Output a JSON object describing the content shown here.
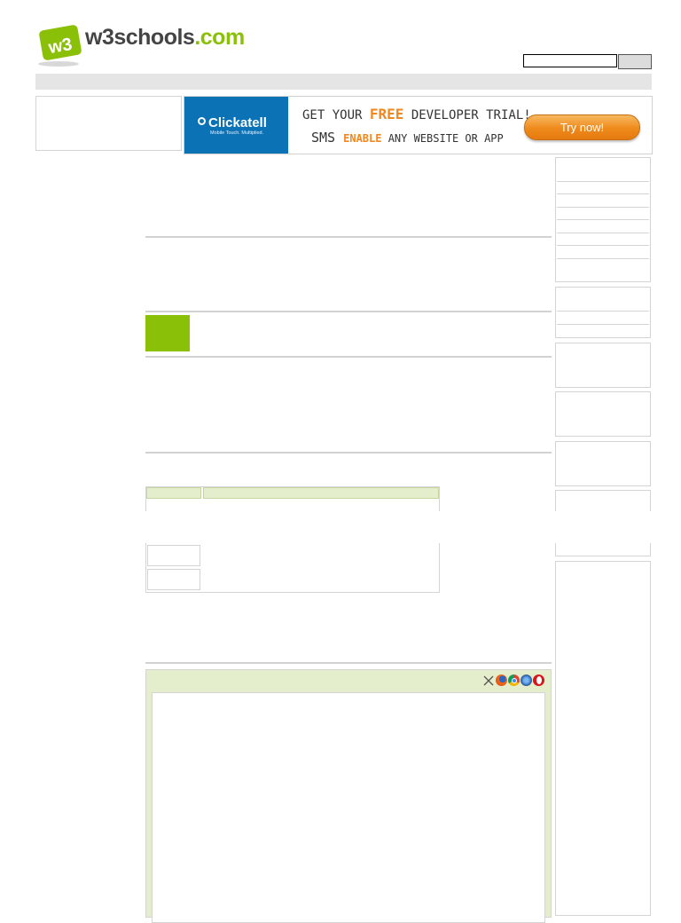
{
  "brand": {
    "word": "w3schools",
    "domain": ".com",
    "badge": "w3",
    "accent": "#8ac007"
  },
  "search": {
    "placeholder": "",
    "button_label": ""
  },
  "ad": {
    "advertiser": "Clickatell",
    "tagline": "Mobile Touch. Multiplied.",
    "line1": [
      "GET YOUR ",
      "FREE",
      " DEVELOPER TRIAL!"
    ],
    "line2": [
      "SMS ",
      "ENABLE",
      " ANY WEBSITE OR APP"
    ],
    "cta": "Try now!",
    "brand_color": "#0c72b6",
    "cta_color": "#ef8a1c"
  },
  "example": {
    "browser_icons": [
      "close-icon",
      "firefox-icon",
      "chrome-icon",
      "safari-icon",
      "opera-icon"
    ]
  },
  "colors": {
    "nav_bar": "#e5e5e5",
    "example_bg": "#e5eecc",
    "divider": "#d2d2d2"
  }
}
